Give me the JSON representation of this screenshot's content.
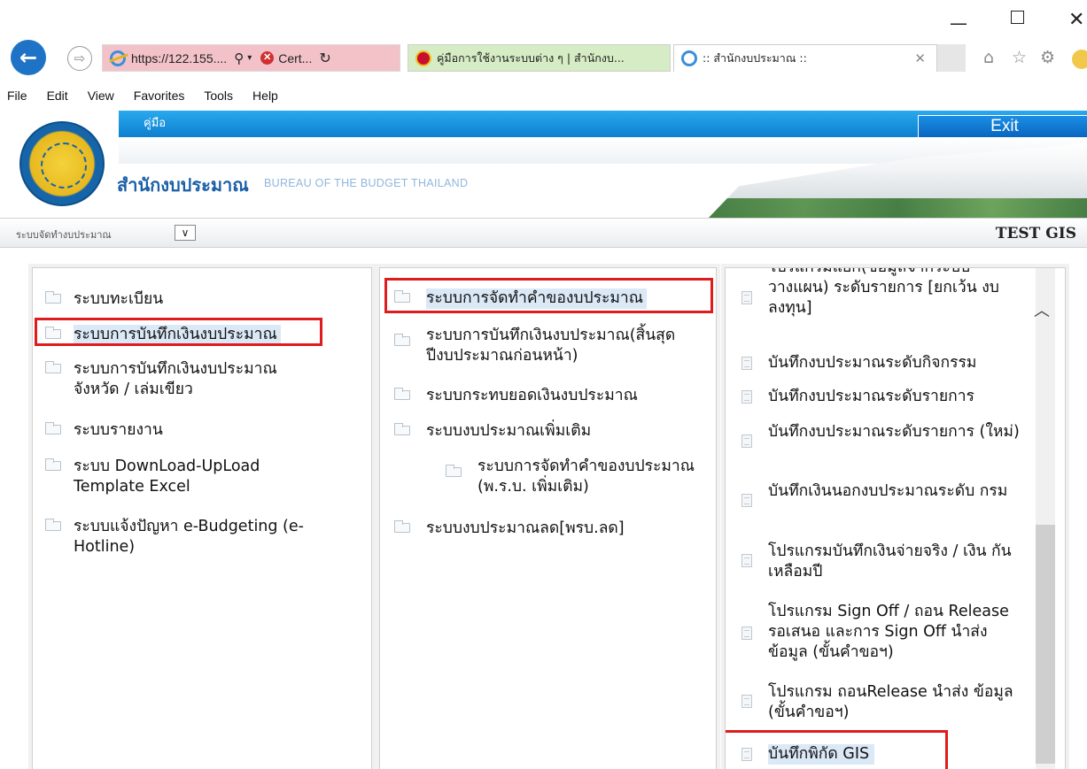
{
  "window": {
    "min": "—",
    "max": "☐",
    "close": "✕"
  },
  "browser": {
    "address_url": "https://122.155....",
    "search_glyph": "⚲",
    "dropdown_glyph": "▾",
    "cert_label": "Cert...",
    "refresh_glyph": "↻",
    "tabs": [
      {
        "title": "คู่มือการใช้งานระบบต่าง ๆ | สำนักงบ...",
        "active": false
      },
      {
        "title": ":: สำนักงบประมาณ ::",
        "active": true,
        "close": "✕"
      }
    ]
  },
  "menu": [
    "File",
    "Edit",
    "View",
    "Favorites",
    "Tools",
    "Help"
  ],
  "header": {
    "manual_link": "คู่มือ",
    "exit_label": "Exit",
    "brand_th": "สำนักงบประมาณ",
    "brand_en": "BUREAU OF THE BUDGET THAILAND"
  },
  "selector": {
    "label": "ระบบจัดทำงบประมาณ",
    "dd_glyph": "∨",
    "user": "TEST GIS"
  },
  "panel1": {
    "items": [
      "ระบบทะเบียน",
      "ระบบการบันทึกเงินงบประมาณ",
      "ระบบการบันทึกเงินงบประมาณ จังหวัด / เล่มเขียว",
      "ระบบรายงาน",
      "ระบบ DownLoad-UpLoad Template Excel",
      "ระบบแจ้งปัญหา e-Budgeting (e-Hotline)"
    ]
  },
  "panel2": {
    "items": [
      "ระบบการจัดทำคำของบประมาณ",
      "ระบบการบันทึกเงินงบประมาณ(สิ้นสุดปีงบประมาณก่อนหน้า)",
      "ระบบกระทบยอดเงินงบประมาณ",
      "ระบบงบประมาณเพิ่มเติม",
      "ระบบการจัดทำคำของบประมาณ (พ.ร.บ. เพิ่มเติม)",
      "ระบบงบประมาณลด[พรบ.ลด]"
    ]
  },
  "panel3": {
    "items": [
      "โปรแกรมแยก(ข้อมูลจากระบบ วางแผน) ระดับรายการ [ยกเว้น งบลงทุน]",
      "บันทึกงบประมาณระดับกิจกรรม",
      "บันทึกงบประมาณระดับรายการ",
      "บันทึกงบประมาณระดับรายการ (ใหม่)",
      "บันทึกเงินนอกงบประมาณระดับ กรม",
      "โปรแกรมบันทึกเงินจ่ายจริง / เงิน กันเหลือมปี",
      "โปรแกรม Sign Off / ถอน Release รอเสนอ และการ Sign Off นำส่งข้อมูล (ขั้นคำขอฯ)",
      "โปรแกรม ถอนRelease นำส่ง ข้อมูล (ขั้นคำขอฯ)",
      "บันทึกพิกัด GIS"
    ],
    "scroll_up": "︿"
  }
}
